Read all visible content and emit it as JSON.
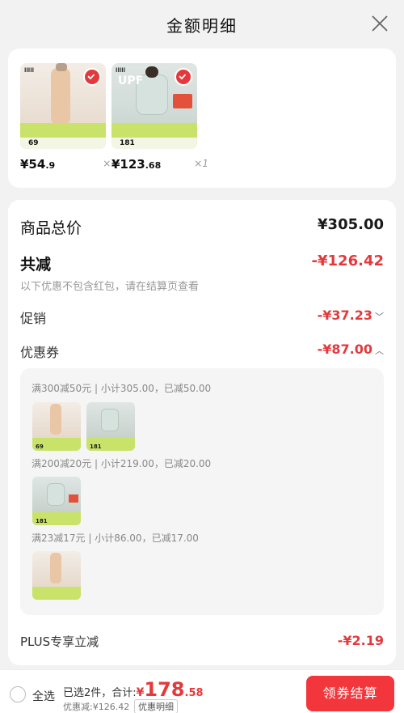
{
  "header": {
    "title": "金额明细"
  },
  "products": [
    {
      "price_int": "¥54",
      "price_dec": ".9",
      "qty": "×1",
      "thumb_price": "69"
    },
    {
      "price_int": "¥123",
      "price_dec": ".68",
      "qty": "×1",
      "thumb_price": "181"
    }
  ],
  "summary": {
    "total_label": "商品总价",
    "total_value": "¥305.00",
    "discount_label": "共减",
    "discount_value": "-¥126.42",
    "discount_note": "以下优惠不包含红包，请在结算页查看",
    "promo_label": "促销",
    "promo_value": "-¥37.23",
    "coupon_label": "优惠券",
    "coupon_value": "-¥87.00",
    "plus_label": "PLUS专享立减",
    "plus_value": "-¥2.19"
  },
  "coupons": [
    {
      "text": "满300减50元 | 小计305.00，已减50.00"
    },
    {
      "text": "满200减20元 | 小计219.00，已减20.00"
    },
    {
      "text": "满23减17元 | 小计86.00，已减17.00"
    }
  ],
  "footer": {
    "select_all": "全选",
    "selected_text": "已选2件，合计:",
    "currency": "¥",
    "total_int": "178",
    "total_dec": ".58",
    "discount_text": "优惠减:¥126.42",
    "detail_button": "优惠明细",
    "checkout_button": "领券结算"
  },
  "colors": {
    "accent": "#e4393c",
    "checkout": "#f2363c"
  }
}
